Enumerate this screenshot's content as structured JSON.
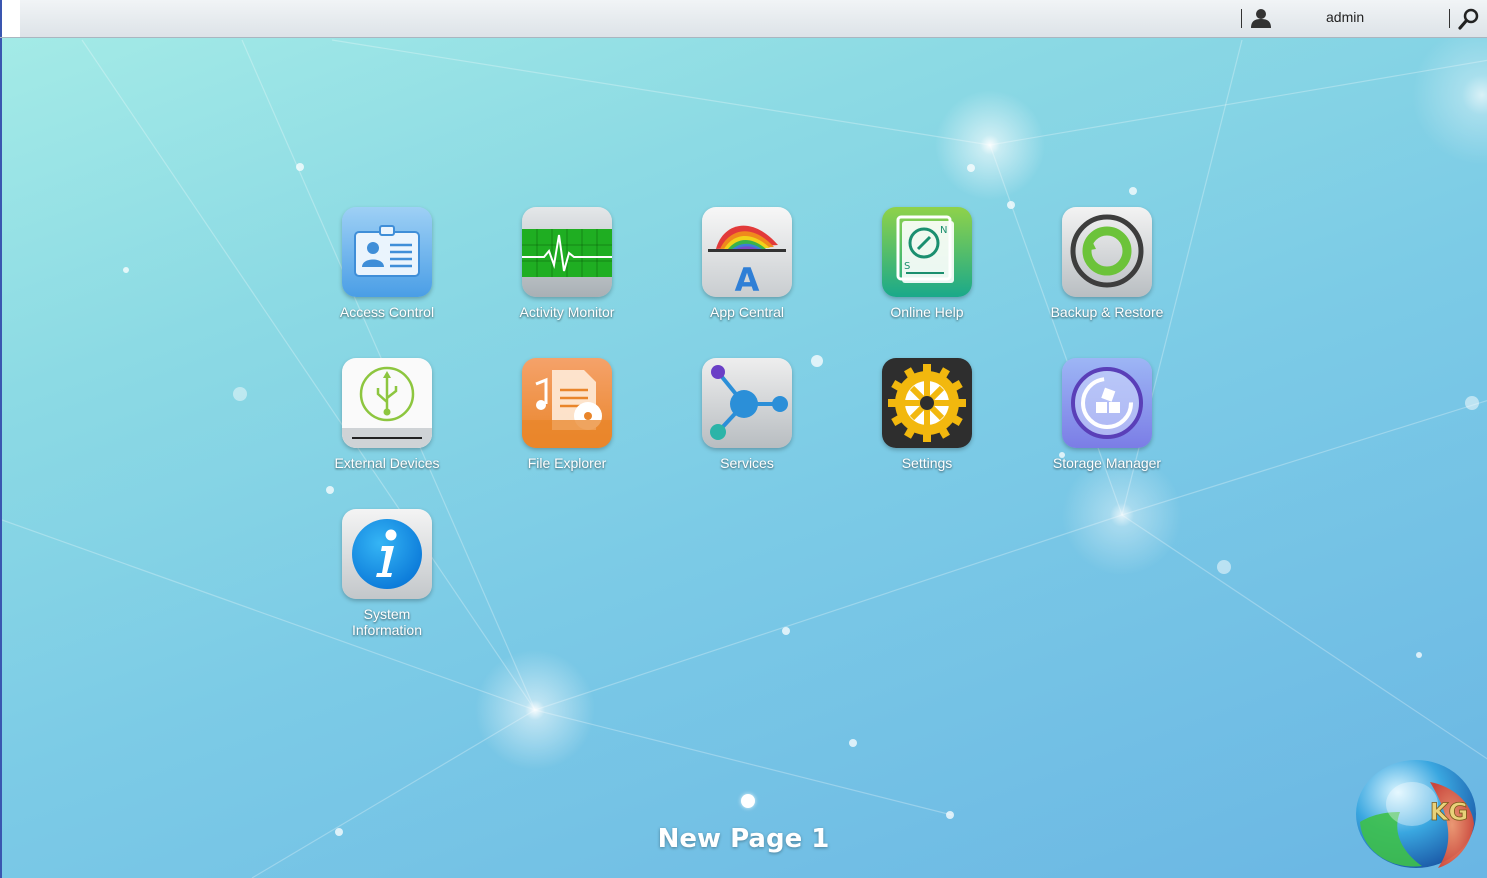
{
  "topbar": {
    "username": "admin",
    "user_icon": "user-icon",
    "search_icon": "search-icon"
  },
  "apps": [
    {
      "label": "Access Control",
      "icon": "id-card-icon"
    },
    {
      "label": "Activity Monitor",
      "icon": "heartbeat-monitor-icon"
    },
    {
      "label": "App Central",
      "icon": "app-central-icon"
    },
    {
      "label": "Online Help",
      "icon": "help-book-icon"
    },
    {
      "label": "Backup & Restore",
      "icon": "backup-restore-icon"
    },
    {
      "label": "External Devices",
      "icon": "usb-icon"
    },
    {
      "label": "File Explorer",
      "icon": "file-explorer-icon"
    },
    {
      "label": "Services",
      "icon": "services-icon"
    },
    {
      "label": "Settings",
      "icon": "gear-icon"
    },
    {
      "label": "Storage Manager",
      "icon": "storage-manager-icon"
    },
    {
      "label": "System Information",
      "label_line1": "System",
      "label_line2": "Information",
      "icon": "info-icon"
    }
  ],
  "pager": {
    "title": "New Page 1",
    "active_page": 1,
    "total_pages": 1
  },
  "watermark": {
    "text": "KG",
    "icon": "kg-logo-icon"
  },
  "colors": {
    "accent": "#3a56b0",
    "label_text": "#ffffff"
  }
}
